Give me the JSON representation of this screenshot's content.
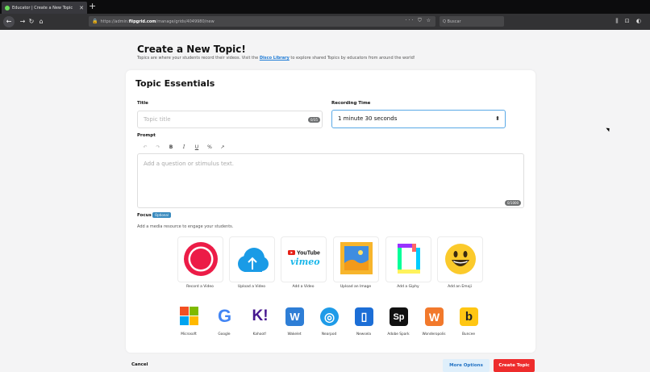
{
  "browser": {
    "tab_title": "Educator | Create a New Topic",
    "tab_close": "✕",
    "new_tab": "+",
    "url_prefix": "https://admin.",
    "url_domain": "flipgrid.com",
    "url_path": "/manage/grids/4049980/new",
    "url_actions": "··· ⛉ ☆",
    "search_placeholder": "Q  Buscar",
    "nav_right": "⫼ ⊡ ◐",
    "accent": "#6cdc5c"
  },
  "header": {
    "title": "Create a New Topic!",
    "subtitle_before": "Topics are where your students record their videos. Visit the ",
    "subtitle_link": "Disco Library",
    "subtitle_after": " to explore shared Topics by educators from around the world!"
  },
  "form": {
    "section_title": "Topic Essentials",
    "title_label": "Title",
    "title_placeholder": "Topic title",
    "title_counter": "0/35",
    "recording_label": "Recording Time",
    "recording_value": "1 minute 30 seconds",
    "prompt_label": "Prompt",
    "toolbar": [
      "↶",
      "↷",
      "B",
      "I",
      "U",
      "%",
      "↗"
    ],
    "prompt_placeholder": "Add a question or stimulus text.",
    "prompt_counter": "0/1000"
  },
  "focus": {
    "label": "Focus",
    "optional_badge": "Optional",
    "subtitle": "Add a media resource to engage your students.",
    "tiles": [
      {
        "label": "Record a Video",
        "icon": "record-icon"
      },
      {
        "label": "Upload a Video",
        "icon": "cloud-upload-icon"
      },
      {
        "label": "Add a Video",
        "icon": "youtube-vimeo-icon",
        "logo_top": "YouTube",
        "logo_bottom": "vimeo"
      },
      {
        "label": "Upload an Image",
        "icon": "image-icon"
      },
      {
        "label": "Add a Giphy",
        "icon": "giphy-icon"
      },
      {
        "label": "Add an Emoji",
        "icon": "emoji-icon"
      }
    ],
    "integrations": [
      {
        "label": "Microsoft",
        "glyph": ""
      },
      {
        "label": "Google",
        "glyph": "G"
      },
      {
        "label": "Kahoot!",
        "glyph": "K!"
      },
      {
        "label": "Wakelet",
        "glyph": "W"
      },
      {
        "label": "Nearpod",
        "glyph": "◎"
      },
      {
        "label": "Newsela",
        "glyph": "▯"
      },
      {
        "label": "Adobe Spark",
        "glyph": "Sp"
      },
      {
        "label": "Wonderopolis",
        "glyph": "W"
      },
      {
        "label": "Buncee",
        "glyph": "b"
      }
    ]
  },
  "footer": {
    "cancel": "Cancel",
    "more_options": "More Options",
    "create_topic": "Create Topic"
  }
}
